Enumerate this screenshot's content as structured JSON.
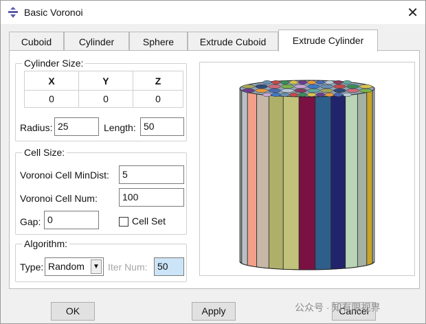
{
  "window": {
    "title": "Basic Voronoi",
    "close_icon": "close-icon"
  },
  "tabs": [
    {
      "label": "Cuboid"
    },
    {
      "label": "Cylinder"
    },
    {
      "label": "Sphere"
    },
    {
      "label": "Extrude Cuboid"
    },
    {
      "label": "Extrude Cylinder"
    }
  ],
  "active_tab": "Extrude Cylinder",
  "cylinder_size": {
    "title": "Cylinder Size:",
    "columns": [
      "X",
      "Y",
      "Z"
    ],
    "values": [
      "0",
      "0",
      "0"
    ],
    "radius_label": "Radius:",
    "radius_value": "25",
    "length_label": "Length:",
    "length_value": "50"
  },
  "cell_size": {
    "title": "Cell Size:",
    "mindist_label": "Voronoi Cell MinDist:",
    "mindist_value": "5",
    "num_label": "Voronoi Cell Num:",
    "num_value": "100",
    "gap_label": "Gap:",
    "gap_value": "0",
    "cellset_label": "Cell Set",
    "cellset_checked": false
  },
  "algorithm": {
    "title": "Algorithm:",
    "type_label": "Type:",
    "type_value": "Random",
    "iter_label": "Iter Num:",
    "iter_value": "50"
  },
  "preview": {
    "stripe_colors": [
      "#8a8f88",
      "#b7c0c6",
      "#f3a08a",
      "#c7b7a8",
      "#aeb06a",
      "#c2c27c",
      "#7a1142",
      "#2d5f8a",
      "#22246b",
      "#b9d4b6",
      "#a3b2a4",
      "#c7a42a",
      "#a2adb8"
    ],
    "top_cap_colors": [
      "#6a8fb3",
      "#c44b4b",
      "#3b8d57",
      "#d8c34f",
      "#6c3d8e",
      "#e89a3c",
      "#4a6ab8",
      "#b8c9d8",
      "#8a3b5e",
      "#5fa8a0",
      "#a6a65a",
      "#2e4a7a",
      "#d16a7c",
      "#7ab34a",
      "#c9a5d8",
      "#3a7ac9"
    ]
  },
  "buttons": {
    "ok": "OK",
    "apply": "Apply",
    "cancel": "Cancel"
  },
  "watermark": "公众号 · 知有限视界"
}
